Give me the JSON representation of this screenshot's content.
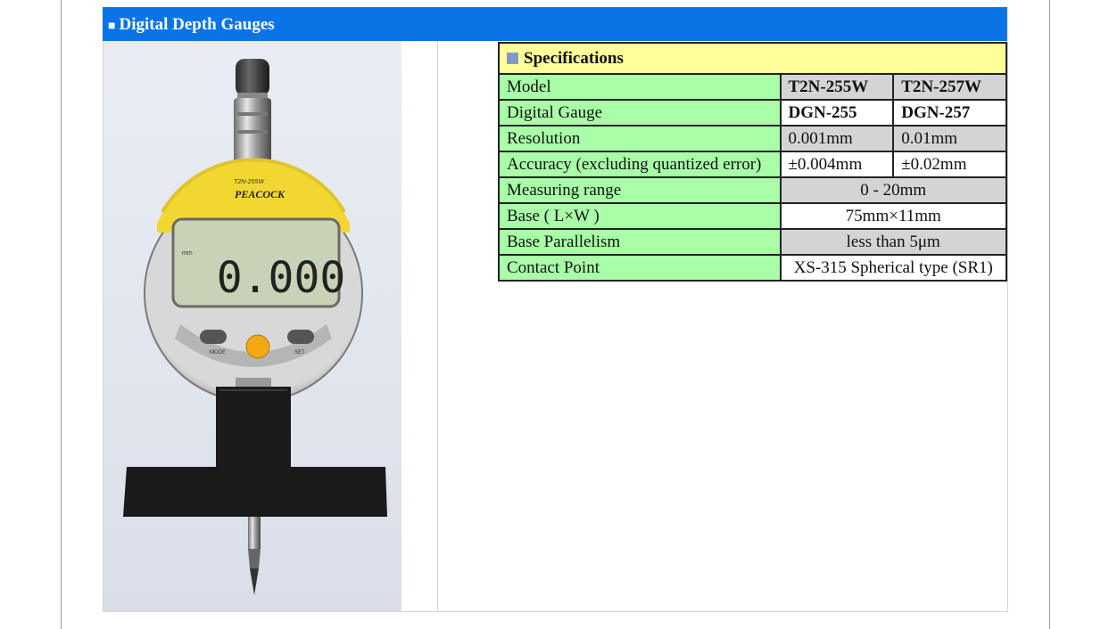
{
  "header": {
    "bullet": "■",
    "title": "Digital Depth Gauges"
  },
  "product_photo": {
    "model_print": "T2N-255W",
    "brand": "PEACOCK",
    "display_value": "0.000",
    "unit": "mm",
    "left_button": "MODE",
    "right_button": "SET",
    "colors": {
      "body_yellow": "#f2d733",
      "lcd": "#c8d2b6"
    }
  },
  "specs": {
    "title": "Specifications",
    "rows": [
      {
        "label": "Model",
        "v1": "T2N-255W",
        "v2": "T2N-257W"
      },
      {
        "label": "Digital Gauge",
        "v1": "DGN-255",
        "v2": "DGN-257"
      },
      {
        "label": "Resolution",
        "v1": "0.001mm",
        "v2": "0.01mm"
      },
      {
        "label": "Accuracy (excluding quantized error)",
        "v1": "±0.004mm",
        "v2": "±0.02mm"
      },
      {
        "label": "Measuring range",
        "value": "0 - 20mm"
      },
      {
        "label": "Base ( L×W )",
        "value": "75mm×11mm"
      },
      {
        "label": "Base Parallelism",
        "value": "less than 5μm"
      },
      {
        "label": "Contact Point",
        "value": "XS-315 Spherical type (SR1)"
      }
    ],
    "colors": {
      "title_bg": "#ffff99",
      "label_bg": "#a8ffa8",
      "gray_bg": "#d4d4d4",
      "header_blue": "#0a73e6"
    }
  }
}
